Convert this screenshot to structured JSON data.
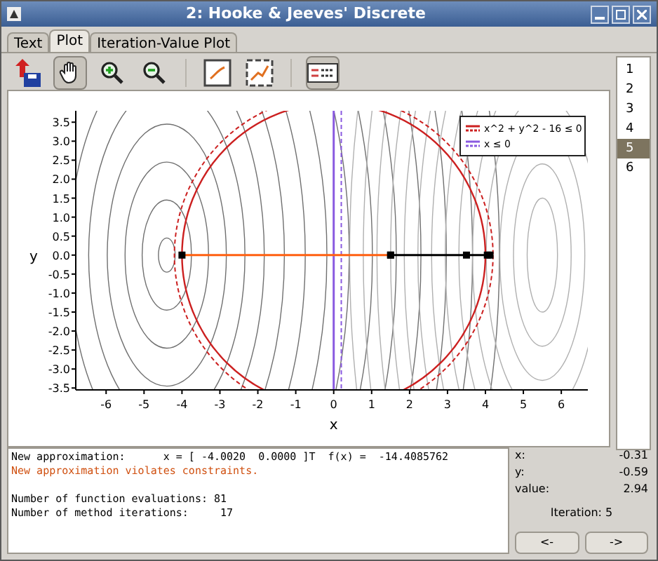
{
  "window": {
    "title": "2: Hooke & Jeeves' Discrete"
  },
  "tabs": [
    {
      "label": "Text",
      "selected": false
    },
    {
      "label": "Plot",
      "selected": true
    },
    {
      "label": "Iteration-Value Plot",
      "selected": false
    }
  ],
  "toolbar": [
    {
      "kind": "save",
      "pressed": false
    },
    {
      "kind": "pan",
      "pressed": true
    },
    {
      "kind": "zoom-in",
      "pressed": false
    },
    {
      "kind": "zoom-out",
      "pressed": false
    },
    {
      "kind": "separator"
    },
    {
      "kind": "fit",
      "pressed": false
    },
    {
      "kind": "fit-data",
      "pressed": false
    },
    {
      "kind": "separator"
    },
    {
      "kind": "legend",
      "pressed": true
    }
  ],
  "plot": {
    "chart_data": {
      "type": "line",
      "xlabel": "x",
      "ylabel": "y",
      "xlim": [
        -6.8,
        6.7
      ],
      "ylim": [
        -3.55,
        3.8
      ],
      "xticks": [
        -6,
        -5,
        -4,
        -3,
        -2,
        -1,
        0,
        1,
        2,
        3,
        4,
        5,
        6
      ],
      "yticks": [
        {
          "value": 3.5,
          "label": "3.5"
        },
        {
          "value": 3,
          "label": "3.0"
        },
        {
          "value": 2.5,
          "label": "2.5"
        },
        {
          "value": 2,
          "label": "2.0"
        },
        {
          "value": 1.5,
          "label": "1.5"
        },
        {
          "value": 1,
          "label": "1.0"
        },
        {
          "value": 0.5,
          "label": "0.5"
        },
        {
          "value": 0,
          "label": "0.0"
        },
        {
          "value": -0.5,
          "label": "-0.5"
        },
        {
          "value": -1,
          "label": "-1.0"
        },
        {
          "value": -1.5,
          "label": "-1.5"
        },
        {
          "value": -2,
          "label": "-2.0"
        },
        {
          "value": -2.5,
          "label": "-2.5"
        },
        {
          "value": -3,
          "label": "-3.0"
        },
        {
          "value": -3.5,
          "label": "-3.5"
        }
      ],
      "series": [
        {
          "name": "x^2 + y^2 - 16 ≤ 0",
          "color": "#cc2020"
        },
        {
          "name": "x ≤ 0",
          "color": "#8a5ae0",
          "x": [
            0,
            0
          ],
          "values": [
            -3.55,
            3.8
          ]
        },
        {
          "color": "#ff6010",
          "marker": "square",
          "x": [
            -4,
            1.5
          ],
          "values": [
            0,
            0
          ]
        },
        {
          "color": "#000000",
          "marker": "square",
          "x": [
            1.5,
            3.5,
            4.05,
            4.12
          ],
          "values": [
            0,
            0,
            0,
            0
          ]
        }
      ],
      "ref_lines": [
        {
          "axis": "x",
          "value": 0.2,
          "color": "#8a5ae0"
        }
      ]
    }
  },
  "iterations": [
    {
      "label": "1",
      "selected": false
    },
    {
      "label": "2",
      "selected": false
    },
    {
      "label": "3",
      "selected": false
    },
    {
      "label": "4",
      "selected": false
    },
    {
      "label": "5",
      "selected": true
    },
    {
      "label": "6",
      "selected": false
    }
  ],
  "log": [
    {
      "kind": "normal",
      "text": "New approximation:      x = [ -4.0020  0.0000 ]T  f(x) =  -14.4085762"
    },
    {
      "kind": "warning",
      "text": "New approximation violates constraints."
    },
    {
      "kind": "blank"
    },
    {
      "kind": "normal",
      "text": "Number of function evaluations: 81"
    },
    {
      "kind": "normal",
      "text": "Number of method iterations:     17"
    }
  ],
  "info": {
    "fields": [
      {
        "label": "x:",
        "value": "-0.31"
      },
      {
        "label": "y:",
        "value": "-0.59"
      },
      {
        "label": "value:",
        "value": "2.94"
      }
    ],
    "iteration": "Iteration: 5",
    "buttons": [
      "<-",
      "->"
    ]
  }
}
